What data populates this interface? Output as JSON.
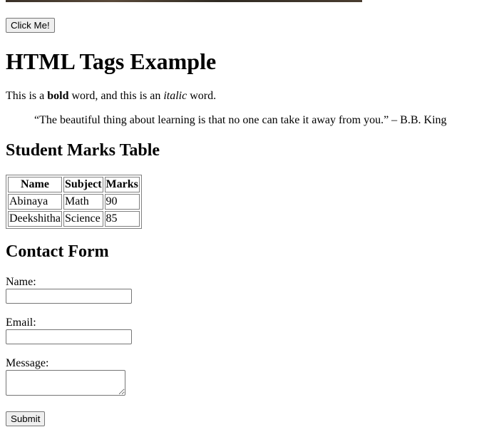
{
  "top_button": {
    "label": "Click Me!"
  },
  "heading": "HTML Tags Example",
  "paragraph": {
    "text1": "This is a ",
    "bold": "bold",
    "text2": " word, and this is an ",
    "italic": "italic",
    "text3": " word."
  },
  "quote": "“The beautiful thing about learning is that no one can take it away from you.” – B.B. King",
  "marks_section": {
    "title": "Student Marks Table",
    "headers": [
      "Name",
      "Subject",
      "Marks"
    ],
    "rows": [
      [
        "Abinaya",
        "Math",
        "90"
      ],
      [
        "Deekshitha",
        "Science",
        "85"
      ]
    ]
  },
  "contact_form": {
    "title": "Contact Form",
    "name_label": "Name:",
    "name_value": "",
    "email_label": "Email:",
    "email_value": "",
    "message_label": "Message:",
    "message_value": "",
    "submit_label": "Submit"
  }
}
